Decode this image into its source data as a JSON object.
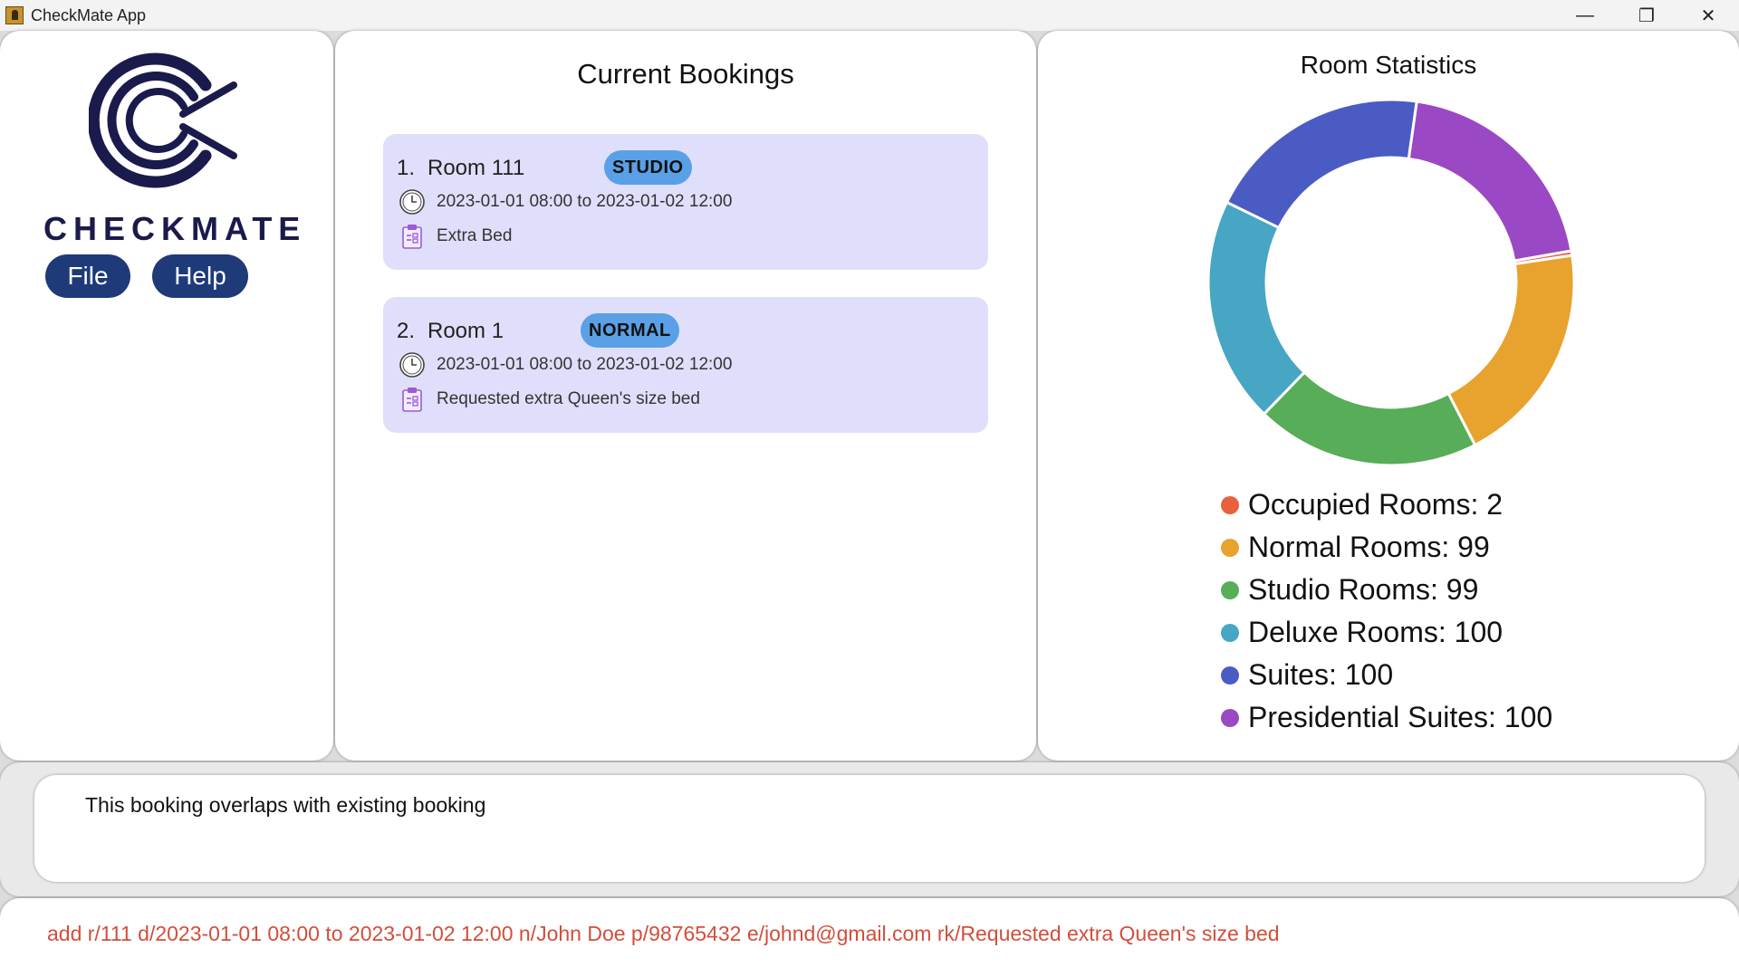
{
  "window": {
    "title": "CheckMate App",
    "controls": [
      "—",
      "❐",
      "✕"
    ]
  },
  "sidebar": {
    "brand": "CHECKMATE",
    "menu": [
      {
        "label": "File"
      },
      {
        "label": "Help"
      }
    ]
  },
  "bookings": {
    "title": "Current Bookings",
    "items": [
      {
        "index": "1.",
        "room": "Room 111",
        "type": "STUDIO",
        "dates": "2023-01-01 08:00 to 2023-01-02 12:00",
        "remark": "Extra Bed"
      },
      {
        "index": "2.",
        "room": "Room 1",
        "type": "NORMAL",
        "dates": "2023-01-01 08:00 to 2023-01-02 12:00",
        "remark": "Requested extra Queen's size bed"
      }
    ]
  },
  "stats": {
    "title": "Room Statistics",
    "chart_data": {
      "type": "pie",
      "donut": true,
      "labels": [
        "Occupied Rooms",
        "Normal Rooms",
        "Studio Rooms",
        "Deluxe Rooms",
        "Suites",
        "Presidential Suites"
      ],
      "values": [
        2,
        99,
        99,
        100,
        100,
        100
      ],
      "colors": [
        "#e8603c",
        "#e8a22e",
        "#58ad58",
        "#46a6c4",
        "#4a5cc4",
        "#9a48c4"
      ],
      "legend_placement": "bottom"
    },
    "legend": [
      {
        "text": "Occupied Rooms: 2"
      },
      {
        "text": "Normal Rooms: 99"
      },
      {
        "text": "Studio Rooms: 99"
      },
      {
        "text": "Deluxe Rooms: 100"
      },
      {
        "text": "Suites: 100"
      },
      {
        "text": "Presidential Suites: 100"
      }
    ]
  },
  "result": {
    "message": "This booking overlaps with existing booking"
  },
  "command": {
    "value": "add r/111 d/2023-01-01 08:00 to 2023-01-02 12:00 n/John Doe p/98765432 e/johnd@gmail.com rk/Requested extra Queen's size bed"
  }
}
